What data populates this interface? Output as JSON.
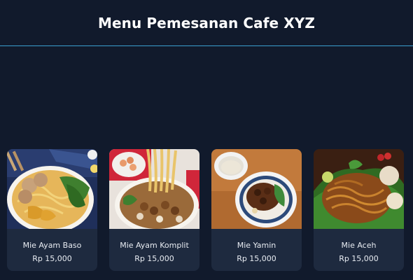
{
  "header": {
    "title": "Menu Pemesanan Cafe XYZ"
  },
  "menu": {
    "items": [
      {
        "name": "Mie Ayam Baso",
        "price": "Rp 15,000",
        "image": "noodles-with-meatballs-photo"
      },
      {
        "name": "Mie Ayam Komplit",
        "price": "Rp 15,000",
        "image": "noodles-with-chicken-and-toppings-photo"
      },
      {
        "name": "Mie Yamin",
        "price": "Rp 15,000",
        "image": "yamin-noodle-bowl-with-soup-photo"
      },
      {
        "name": "Mie Aceh",
        "price": "Rp 15,000",
        "image": "fried-noodles-on-banana-leaf-photo"
      }
    ]
  },
  "colors": {
    "background": "#111a2c",
    "card": "#1e2a3f",
    "header_border": "#3aa0d0",
    "text": "#ffffff"
  }
}
